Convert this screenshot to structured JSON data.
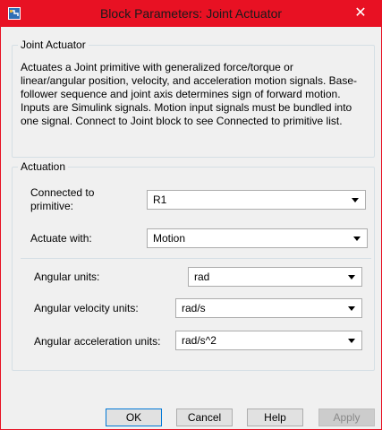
{
  "window": {
    "title": "Block Parameters: Joint Actuator",
    "close_glyph": "✕"
  },
  "block_group": {
    "legend": "Joint Actuator",
    "description": "Actuates a Joint primitive with generalized force/torque or linear/angular position, velocity, and acceleration motion signals. Base-follower sequence and joint axis determines sign of forward motion. Inputs are Simulink signals. Motion input signals must be bundled into one signal. Connect to Joint block to see Connected to primitive list."
  },
  "actuation_group": {
    "legend": "Actuation",
    "connected_to": {
      "label": "Connected to primitive:",
      "value": "R1"
    },
    "actuate_with": {
      "label": "Actuate with:",
      "value": "Motion"
    },
    "angular_units": {
      "label": "Angular units:",
      "value": "rad"
    },
    "angular_velocity_units": {
      "label": "Angular velocity units:",
      "value": "rad/s"
    },
    "angular_acceleration_units": {
      "label": "Angular acceleration units:",
      "value": "rad/s^2"
    }
  },
  "buttons": {
    "ok": "OK",
    "cancel": "Cancel",
    "help": "Help",
    "apply": "Apply"
  },
  "icons": {
    "app": "simulink-icon",
    "dropdown": "chevron-down-icon",
    "close": "close-icon"
  },
  "colors": {
    "titlebar": "#e81123",
    "group_border": "#d5dfe5",
    "window_bg": "#f0f0f0",
    "default_button_border": "#0078d7"
  }
}
